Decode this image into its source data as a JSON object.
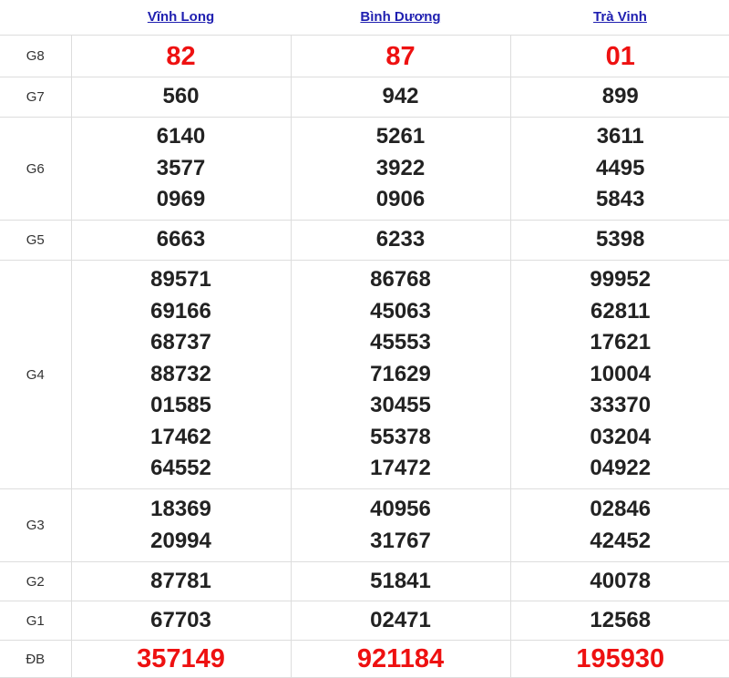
{
  "header": {
    "provinces": [
      "Vĩnh Long",
      "Bình Dương",
      "Trà Vinh"
    ]
  },
  "colors": {
    "link": "#1f1fb0",
    "special_numbers": "#ee1111",
    "numbers": "#222222",
    "grid": "#dddddd"
  },
  "rows": [
    {
      "label": "G8",
      "values": [
        [
          "82"
        ],
        [
          "87"
        ],
        [
          "01"
        ]
      ]
    },
    {
      "label": "G7",
      "values": [
        [
          "560"
        ],
        [
          "942"
        ],
        [
          "899"
        ]
      ]
    },
    {
      "label": "G6",
      "values": [
        [
          "6140",
          "3577",
          "0969"
        ],
        [
          "5261",
          "3922",
          "0906"
        ],
        [
          "3611",
          "4495",
          "5843"
        ]
      ]
    },
    {
      "label": "G5",
      "values": [
        [
          "6663"
        ],
        [
          "6233"
        ],
        [
          "5398"
        ]
      ]
    },
    {
      "label": "G4",
      "values": [
        [
          "89571",
          "69166",
          "68737",
          "88732",
          "01585",
          "17462",
          "64552"
        ],
        [
          "86768",
          "45063",
          "45553",
          "71629",
          "30455",
          "55378",
          "17472"
        ],
        [
          "99952",
          "62811",
          "17621",
          "10004",
          "33370",
          "03204",
          "04922"
        ]
      ]
    },
    {
      "label": "G3",
      "values": [
        [
          "18369",
          "20994"
        ],
        [
          "40956",
          "31767"
        ],
        [
          "02846",
          "42452"
        ]
      ]
    },
    {
      "label": "G2",
      "values": [
        [
          "87781"
        ],
        [
          "51841"
        ],
        [
          "40078"
        ]
      ]
    },
    {
      "label": "G1",
      "values": [
        [
          "67703"
        ],
        [
          "02471"
        ],
        [
          "12568"
        ]
      ]
    },
    {
      "label": "ĐB",
      "values": [
        [
          "357149"
        ],
        [
          "921184"
        ],
        [
          "195930"
        ]
      ]
    }
  ]
}
